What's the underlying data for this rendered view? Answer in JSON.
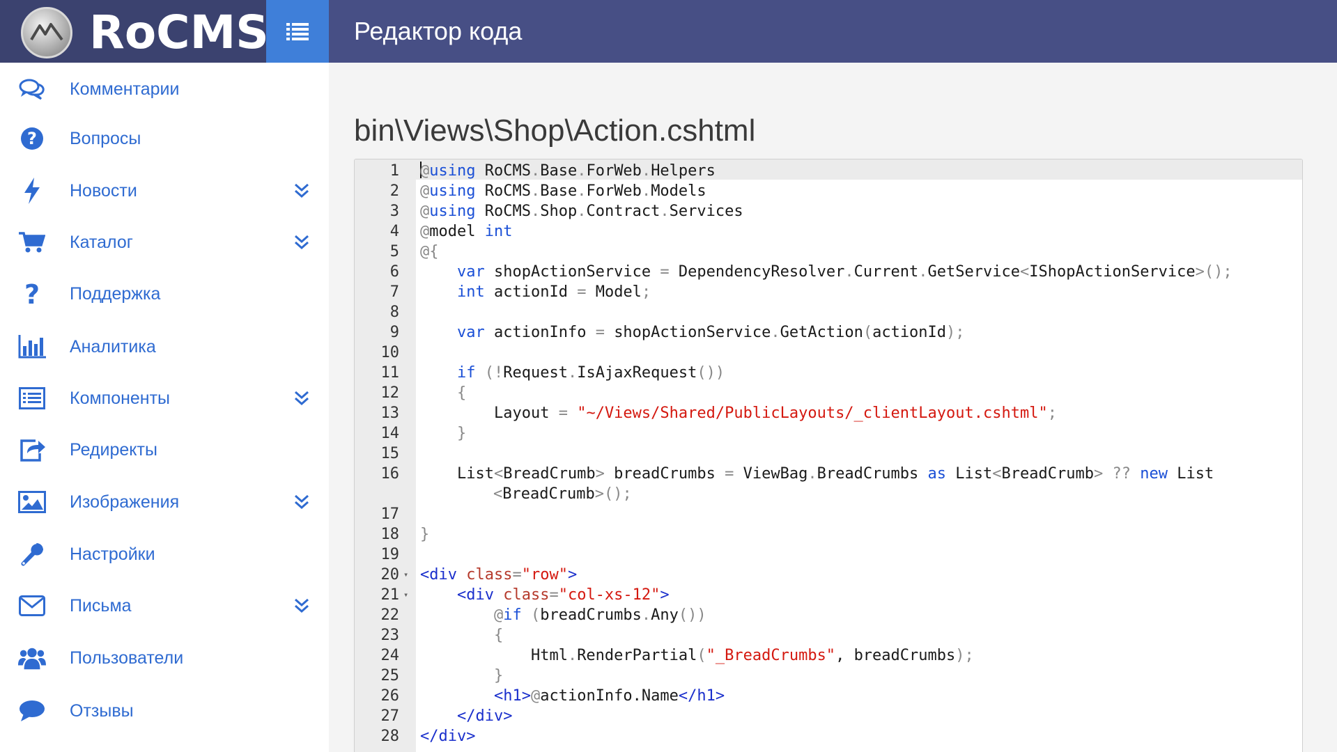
{
  "app": {
    "logo_text": "RoCMS",
    "page_heading": "Редактор кода"
  },
  "colors": {
    "header": "#474f85",
    "toggle": "#3f7fd9",
    "accent": "#2f6bd1"
  },
  "sidebar": {
    "items": [
      {
        "label": "Комментарии",
        "icon": "comments-icon",
        "expandable": false
      },
      {
        "label": "Вопросы",
        "icon": "question-circle-icon",
        "expandable": false
      },
      {
        "label": "Новости",
        "icon": "bolt-icon",
        "expandable": true
      },
      {
        "label": "Каталог",
        "icon": "cart-icon",
        "expandable": true
      },
      {
        "label": "Поддержка",
        "icon": "question-icon",
        "expandable": false
      },
      {
        "label": "Аналитика",
        "icon": "bar-chart-icon",
        "expandable": false
      },
      {
        "label": "Компоненты",
        "icon": "list-alt-icon",
        "expandable": true
      },
      {
        "label": "Редиректы",
        "icon": "share-icon",
        "expandable": false
      },
      {
        "label": "Изображения",
        "icon": "image-icon",
        "expandable": true
      },
      {
        "label": "Настройки",
        "icon": "wrench-icon",
        "expandable": false
      },
      {
        "label": "Письма",
        "icon": "envelope-icon",
        "expandable": true
      },
      {
        "label": "Пользователи",
        "icon": "users-icon",
        "expandable": false
      },
      {
        "label": "Отзывы",
        "icon": "chat-bubble-icon",
        "expandable": false
      }
    ]
  },
  "editor": {
    "file_path": "bin\\Views\\Shop\\Action.cshtml",
    "lines": [
      {
        "n": "1",
        "text": "@using RoCMS.Base.ForWeb.Helpers"
      },
      {
        "n": "2",
        "text": "@using RoCMS.Base.ForWeb.Models"
      },
      {
        "n": "3",
        "text": "@using RoCMS.Shop.Contract.Services"
      },
      {
        "n": "4",
        "text": "@model int"
      },
      {
        "n": "5",
        "text": "@{"
      },
      {
        "n": "6",
        "text": "    var shopActionService = DependencyResolver.Current.GetService<IShopActionService>();"
      },
      {
        "n": "7",
        "text": "    int actionId = Model;"
      },
      {
        "n": "8",
        "text": ""
      },
      {
        "n": "9",
        "text": "    var actionInfo = shopActionService.GetAction(actionId);"
      },
      {
        "n": "10",
        "text": ""
      },
      {
        "n": "11",
        "text": "    if (!Request.IsAjaxRequest())"
      },
      {
        "n": "12",
        "text": "    {"
      },
      {
        "n": "13",
        "text": "        Layout = \"~/Views/Shared/PublicLayouts/_clientLayout.cshtml\";"
      },
      {
        "n": "14",
        "text": "    }"
      },
      {
        "n": "15",
        "text": ""
      },
      {
        "n": "16",
        "text": "    List<BreadCrumb> breadCrumbs = ViewBag.BreadCrumbs as List<BreadCrumb> ?? new List <BreadCrumb>();"
      },
      {
        "n": "17",
        "text": ""
      },
      {
        "n": "18",
        "text": "}"
      },
      {
        "n": "19",
        "text": ""
      },
      {
        "n": "20",
        "text": "<div class=\"row\">"
      },
      {
        "n": "21",
        "text": "    <div class=\"col-xs-12\">"
      },
      {
        "n": "22",
        "text": "        @if (breadCrumbs.Any())"
      },
      {
        "n": "23",
        "text": "        {"
      },
      {
        "n": "24",
        "text": "            Html.RenderPartial(\"_BreadCrumbs\", breadCrumbs);"
      },
      {
        "n": "25",
        "text": "        }"
      },
      {
        "n": "26",
        "text": "        <h1>@actionInfo.Name</h1>"
      },
      {
        "n": "27",
        "text": "    </div>"
      },
      {
        "n": "28",
        "text": "</div>"
      }
    ]
  }
}
